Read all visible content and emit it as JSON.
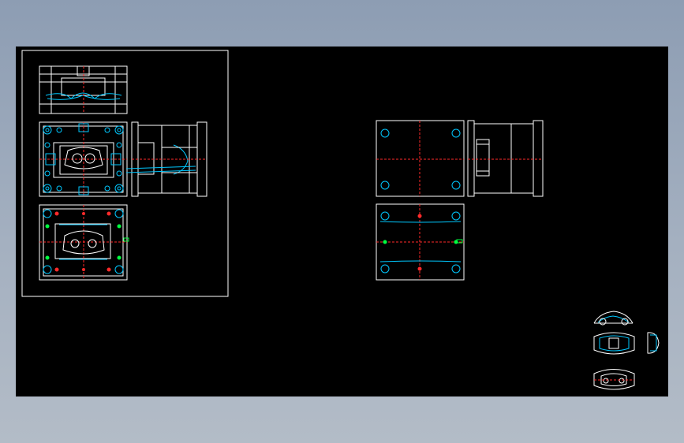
{
  "canvas": {
    "background": "#000000",
    "outer_background": "#9aa7b8"
  },
  "colors": {
    "outline": "#ffffff",
    "cyan": "#00c8ff",
    "red_centerline": "#ff2a2a",
    "green": "#00ff40"
  },
  "drawing_sheet": {
    "label_line1": "",
    "label_line2": ""
  }
}
